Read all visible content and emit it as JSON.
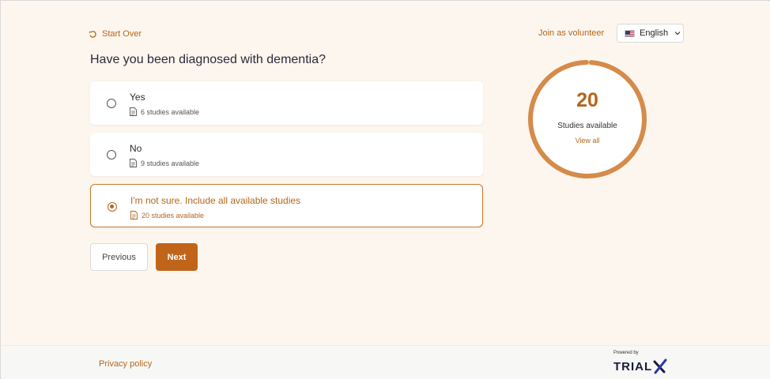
{
  "header": {
    "start_over": "Start Over",
    "join": "Join as volunteer",
    "language": "English"
  },
  "question": "Have you been diagnosed with dementia?",
  "options": [
    {
      "label": "Yes",
      "count": "6 studies available",
      "selected": false
    },
    {
      "label": "No",
      "count": "9 studies available",
      "selected": false
    },
    {
      "label": "I'm not sure. Include all available studies",
      "count": "20 studies available",
      "selected": true
    }
  ],
  "buttons": {
    "previous": "Previous",
    "next": "Next"
  },
  "summary": {
    "count": "20",
    "label": "Studies available",
    "link": "View all"
  },
  "footer": {
    "privacy": "Privacy policy",
    "powered": "Powered by",
    "brand_text": "TRIAL"
  },
  "colors": {
    "accent": "#b5651d",
    "button": "#c0641a",
    "background": "#fdf6ee",
    "ring": "#d58b4a"
  },
  "icons": {
    "start_over": "rotate-ccw-icon",
    "language": "us-flag-icon",
    "dropdown": "chevron-down-icon",
    "study_count": "document-icon"
  }
}
